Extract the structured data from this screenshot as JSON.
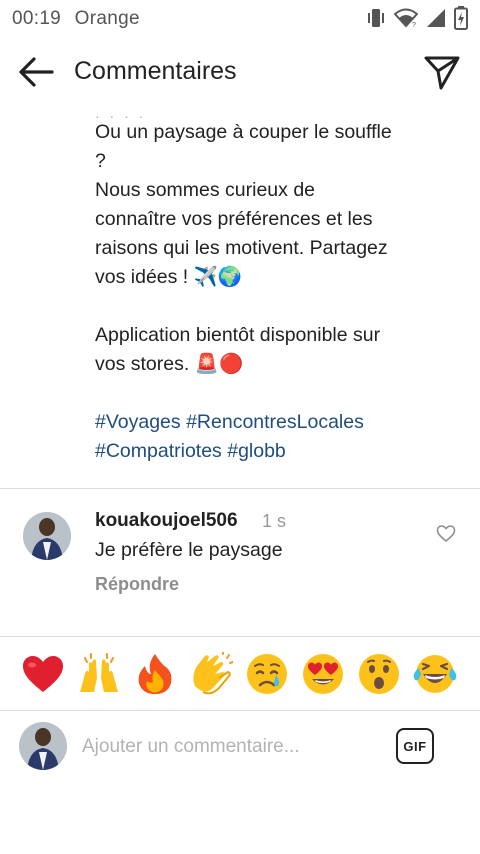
{
  "status_bar": {
    "time": "00:19",
    "carrier": "Orange",
    "icons": [
      "vibrate-icon",
      "wifi-icon",
      "signal-icon",
      "battery-charging-icon"
    ]
  },
  "header": {
    "title": "Commentaires",
    "back_icon": "arrow-left-icon",
    "send_icon": "paper-plane-icon"
  },
  "caption": {
    "lines": [
      "Ou un paysage à couper le souffle",
      "?",
      "Nous sommes curieux de",
      "connaître vos préférences et les",
      "raisons qui les motivent. Partagez",
      "vos idées ! ✈️🌍"
    ],
    "paragraph2": [
      "Application bientôt disponible sur",
      "vos stores. 🚨🔴"
    ],
    "hashtags": [
      "#Voyages #RencontresLocales",
      "#Compatriotes #globb"
    ]
  },
  "comment": {
    "username": "kouakoujoel506",
    "time": "1 s",
    "text": "Je préfère le paysage",
    "reply_label": "Répondre",
    "like_icon": "heart-outline-icon"
  },
  "emoji_bar": [
    {
      "emoji": "❤️",
      "name": "heart"
    },
    {
      "emoji": "🙌",
      "name": "raising-hands"
    },
    {
      "emoji": "🔥",
      "name": "fire"
    },
    {
      "emoji": "👏",
      "name": "clapping-hands"
    },
    {
      "emoji": "😢",
      "name": "crying-face"
    },
    {
      "emoji": "😍",
      "name": "heart-eyes"
    },
    {
      "emoji": "😮",
      "name": "surprised-face"
    },
    {
      "emoji": "😂",
      "name": "tears-of-joy"
    }
  ],
  "input": {
    "placeholder": "Ajouter un commentaire...",
    "gif_label": "GIF"
  },
  "colors": {
    "hashtag": "#1f4d80",
    "muted": "#8e8e8e",
    "divider": "#dcdcdc"
  }
}
